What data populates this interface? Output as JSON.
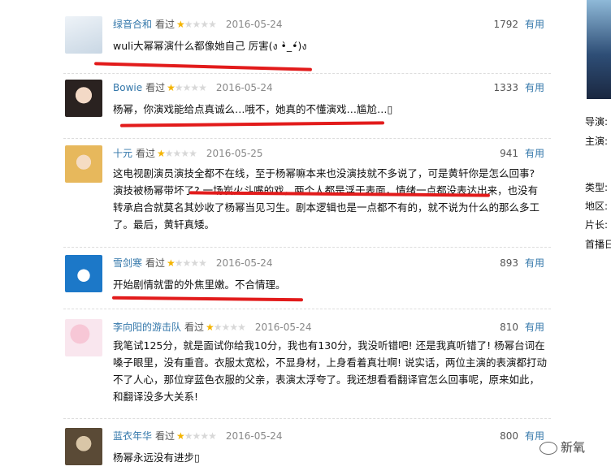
{
  "reviews": [
    {
      "user": "绿音合和",
      "seen": "看过",
      "stars": 1,
      "date": "2016-05-24",
      "votes": "1792",
      "useful": "有用",
      "text": "wuli大幂幂演什么都像她自己 厉害(ง •̀_•́)ง"
    },
    {
      "user": "Bowie",
      "seen": "看过",
      "stars": 1,
      "date": "2016-05-24",
      "votes": "1333",
      "useful": "有用",
      "text": "杨幂，你演戏能给点真诚么…哦不，她真的不懂演戏…尴尬…▯"
    },
    {
      "user": "十元",
      "seen": "看过",
      "stars": 1,
      "date": "2016-05-25",
      "votes": "941",
      "useful": "有用",
      "text": "这电视剧演员演技全都不在线，至于杨幂嘛本来也没演技就不多说了，可是黄轩你是怎么回事? 演技被杨幂带坏了? 一场炭火斗嘴的戏，两个人都是浮于表面，情绪一点都没表达出来，也没有转承启合就莫名其妙收了杨幂当见习生。剧本逻辑也是一点都不有的，就不说为什么的那么多工了。最后，黄轩真矮。"
    },
    {
      "user": "雪剑寒",
      "seen": "看过",
      "stars": 1,
      "date": "2016-05-24",
      "votes": "893",
      "useful": "有用",
      "text": "开始剧情就雷的外焦里嫩。不合情理。"
    },
    {
      "user": "李向阳的游击队",
      "seen": "看过",
      "stars": 1,
      "date": "2016-05-24",
      "votes": "810",
      "useful": "有用",
      "text": "我笔试125分，就是面试你给我10分，我也有130分，我没听错吧! 还是我真听错了! 杨幂台词在嗓子眼里，没有重音。衣服太宽松，不显身材，上身看着真壮啊! 说实话，两位主演的表演都打动不了人心，那位穿蓝色衣服的父亲，表演太浮夸了。我还想看看翻译官怎么回事呢，原来如此，和翻译没多大关系!"
    },
    {
      "user": "蓝衣年华",
      "seen": "看过",
      "stars": 1,
      "date": "2016-05-24",
      "votes": "800",
      "useful": "有用",
      "text": "杨幂永远没有进步▯"
    }
  ],
  "sidebar": {
    "labels": [
      "导演:",
      "主演:",
      "类型:",
      "地区:",
      "片长:",
      "首播日"
    ]
  },
  "watermark": {
    "text": "新氧"
  }
}
